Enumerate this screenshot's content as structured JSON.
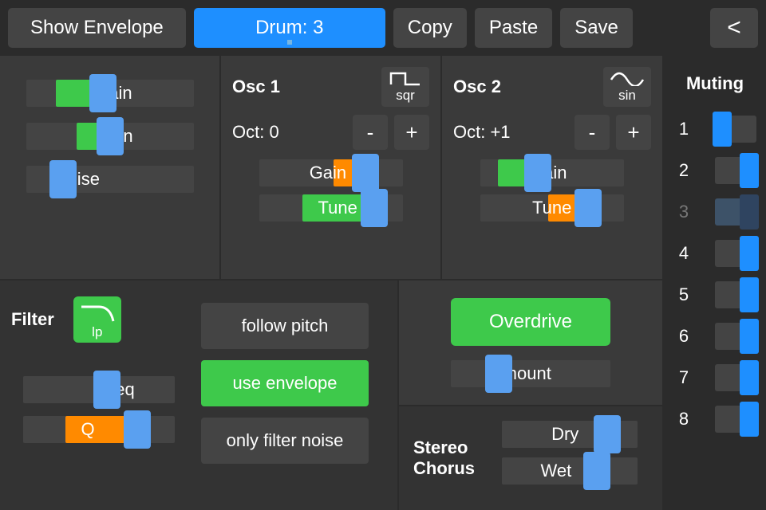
{
  "topbar": {
    "show_envelope": "Show Envelope",
    "drum_label": "Drum: 3",
    "copy": "Copy",
    "paste": "Paste",
    "save": "Save",
    "back": "<"
  },
  "master": {
    "gain": {
      "label": "Gain",
      "value": 0.46,
      "fill_start": 0.18,
      "fill_color": "#3ec94b"
    },
    "pan": {
      "label": "Pan",
      "value": 0.5,
      "fill_start": 0.3,
      "fill_color": "#3ec94b"
    },
    "noise": {
      "label": "Noise",
      "value": 0.22,
      "fill_start": 0.22,
      "fill_color": "transparent"
    }
  },
  "osc1": {
    "title": "Osc 1",
    "wave": "sqr",
    "oct_label": "Oct: 0",
    "minus": "-",
    "plus": "+",
    "gain": {
      "label": "Gain",
      "value": 0.74,
      "fill_start": 0.52,
      "fill_color": "#ff8a00"
    },
    "tune": {
      "label": "Tune",
      "value": 0.8,
      "fill_start": 0.3,
      "fill_color": "#3ec94b"
    }
  },
  "osc2": {
    "title": "Osc 2",
    "wave": "sin",
    "oct_label": "Oct: +1",
    "minus": "-",
    "plus": "+",
    "gain": {
      "label": "Gain",
      "value": 0.4,
      "fill_start": 0.12,
      "fill_color": "#3ec94b"
    },
    "tune": {
      "label": "Tune",
      "value": 0.75,
      "fill_start": 0.47,
      "fill_color": "#ff8a00"
    }
  },
  "filter": {
    "title": "Filter",
    "type": "lp",
    "freq": {
      "label": "Freq",
      "value": 0.55,
      "fill_start": 0.55,
      "fill_color": "transparent"
    },
    "q": {
      "label": "Q",
      "value": 0.75,
      "fill_start": 0.28,
      "fill_color": "#ff8a00"
    },
    "follow_pitch": {
      "label": "follow pitch",
      "on": false
    },
    "use_envelope": {
      "label": "use envelope",
      "on": true
    },
    "only_filter_noise": {
      "label": "only filter noise",
      "on": false
    }
  },
  "overdrive": {
    "label": "Overdrive",
    "amount": {
      "label": "Amount",
      "value": 0.3,
      "fill_start": 0.3,
      "fill_color": "transparent"
    }
  },
  "chorus": {
    "title1": "Stereo",
    "title2": "Chorus",
    "dry": {
      "label": "Dry",
      "value": 0.78,
      "fill_start": 0.78,
      "fill_color": "transparent"
    },
    "wet": {
      "label": "Wet",
      "value": 0.7,
      "fill_start": 0.7,
      "fill_color": "transparent"
    }
  },
  "muting": {
    "title": "Muting",
    "tracks": [
      {
        "num": "1",
        "state": "off",
        "disabled": false
      },
      {
        "num": "2",
        "state": "on",
        "disabled": false
      },
      {
        "num": "3",
        "state": "on",
        "disabled": true
      },
      {
        "num": "4",
        "state": "on",
        "disabled": false
      },
      {
        "num": "5",
        "state": "on",
        "disabled": false
      },
      {
        "num": "6",
        "state": "on",
        "disabled": false
      },
      {
        "num": "7",
        "state": "on",
        "disabled": false
      },
      {
        "num": "8",
        "state": "on",
        "disabled": false
      }
    ]
  }
}
